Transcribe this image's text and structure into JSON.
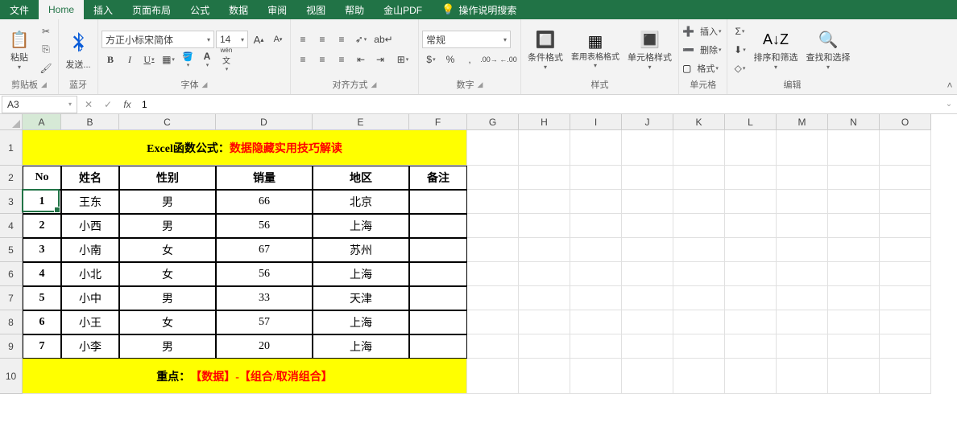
{
  "tabs": {
    "file": "文件",
    "home": "Home",
    "insert": "插入",
    "layout": "页面布局",
    "formula": "公式",
    "data": "数据",
    "review": "审阅",
    "view": "视图",
    "help": "帮助",
    "wps": "金山PDF",
    "search": "操作说明搜索"
  },
  "ribbon": {
    "clipboard": {
      "paste": "粘贴",
      "label": "剪贴板"
    },
    "bluetooth": {
      "send": "发送...",
      "label": "蓝牙"
    },
    "font": {
      "name": "方正小标宋简体",
      "size": "14",
      "pinyin": "wén",
      "label": "字体"
    },
    "align": {
      "label": "对齐方式"
    },
    "number": {
      "format": "常规",
      "label": "数字"
    },
    "styles": {
      "cond": "条件格式",
      "table": "套用表格格式",
      "cell": "单元格样式",
      "label": "样式"
    },
    "cells": {
      "insert": "插入",
      "delete": "删除",
      "format": "格式",
      "label": "单元格"
    },
    "editing": {
      "sort": "排序和筛选",
      "find": "查找和选择",
      "label": "编辑"
    }
  },
  "namebox": "A3",
  "formula": "1",
  "columns": [
    {
      "l": "A",
      "w": 48
    },
    {
      "l": "B",
      "w": 72
    },
    {
      "l": "C",
      "w": 120
    },
    {
      "l": "D",
      "w": 120
    },
    {
      "l": "E",
      "w": 120
    },
    {
      "l": "F",
      "w": 72
    },
    {
      "l": "G",
      "w": 64
    },
    {
      "l": "H",
      "w": 64
    },
    {
      "l": "I",
      "w": 64
    },
    {
      "l": "J",
      "w": 64
    },
    {
      "l": "K",
      "w": 64
    },
    {
      "l": "L",
      "w": 64
    },
    {
      "l": "M",
      "w": 64
    },
    {
      "l": "N",
      "w": 64
    },
    {
      "l": "O",
      "w": 64
    }
  ],
  "rows": [
    {
      "n": 1,
      "h": 44
    },
    {
      "n": 2,
      "h": 30
    },
    {
      "n": 3,
      "h": 30
    },
    {
      "n": 4,
      "h": 30
    },
    {
      "n": 5,
      "h": 30
    },
    {
      "n": 6,
      "h": 30
    },
    {
      "n": 7,
      "h": 30
    },
    {
      "n": 8,
      "h": 30
    },
    {
      "n": 9,
      "h": 30
    },
    {
      "n": 10,
      "h": 44
    }
  ],
  "title": {
    "black": "Excel函数公式：",
    "red": "数据隐藏实用技巧解读"
  },
  "headers": [
    "No",
    "姓名",
    "性别",
    "销量",
    "地区",
    "备注"
  ],
  "data": [
    [
      "1",
      "王东",
      "男",
      "66",
      "北京",
      ""
    ],
    [
      "2",
      "小西",
      "男",
      "56",
      "上海",
      ""
    ],
    [
      "3",
      "小南",
      "女",
      "67",
      "苏州",
      ""
    ],
    [
      "4",
      "小北",
      "女",
      "56",
      "上海",
      ""
    ],
    [
      "5",
      "小中",
      "男",
      "33",
      "天津",
      ""
    ],
    [
      "6",
      "小王",
      "女",
      "57",
      "上海",
      ""
    ],
    [
      "7",
      "小李",
      "男",
      "20",
      "上海",
      ""
    ]
  ],
  "footer": {
    "black": "重点：",
    "red": "【数据】-【组合/取消组合】"
  },
  "active_cell": {
    "col": 0,
    "row": 2
  }
}
